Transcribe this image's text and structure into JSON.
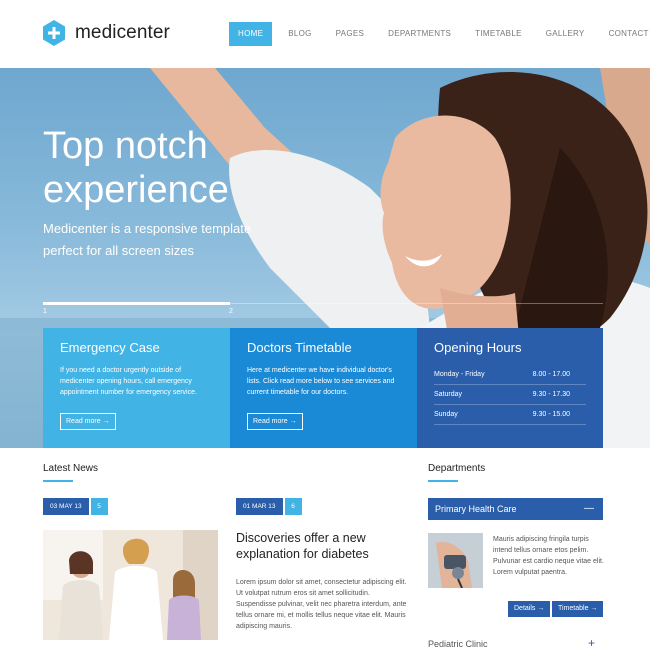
{
  "brand": {
    "name": "medicenter",
    "color": "#42b3e5"
  },
  "nav": [
    {
      "label": "HOME",
      "active": true
    },
    {
      "label": "BLOG"
    },
    {
      "label": "PAGES"
    },
    {
      "label": "DEPARTMENTS"
    },
    {
      "label": "TIMETABLE"
    },
    {
      "label": "GALLERY"
    },
    {
      "label": "CONTACT"
    }
  ],
  "hero": {
    "title_line1": "Top notch",
    "title_line2": "experience",
    "subtitle_line1": "Medicenter is a responsive template",
    "subtitle_line2": "perfect for all screen sizes",
    "slides": [
      "1",
      "2"
    ]
  },
  "boxes": {
    "emergency": {
      "title": "Emergency Case",
      "text": "If you need a doctor urgently outside of medicenter opening hours, call emergency appointment number for emergency service.",
      "button": "Read more →"
    },
    "timetable": {
      "title": "Doctors Timetable",
      "text": "Here at medicenter we have individual doctor's lists. Click read more below to see services and current timetable for our doctors.",
      "button": "Read more →"
    },
    "hours": {
      "title": "Opening Hours",
      "rows": [
        {
          "day": "Monday - Friday",
          "time": "8.00 - 17.00"
        },
        {
          "day": "Saturday",
          "time": "9.30 - 17.30"
        },
        {
          "day": "Sunday",
          "time": "9.30 - 15.00"
        }
      ]
    }
  },
  "news": {
    "heading": "Latest News",
    "items": [
      {
        "date": "03 MAY 13",
        "count": "5"
      },
      {
        "date": "01 MAR 13",
        "count": "6",
        "title": "Discoveries offer a new explanation for diabetes",
        "text": "Lorem ipsum dolor sit amet, consectetur adipiscing elit. Ut volutpat rutrum eros sit amet sollicitudin. Suspendisse pulvinar, velit nec pharetra interdum, ante tellus ornare mi, et mollis tellus neque vitae elit. Mauris adipiscing mauris."
      }
    ]
  },
  "departments": {
    "heading": "Departments",
    "open": {
      "title": "Primary Health Care",
      "text": "Mauris adipiscing fringila turpis intend tellus ornare etos pelim. Pulvunar est cardio neque vitae elit. Lorem vulputat paentra.",
      "details_button": "Details →",
      "timetable_button": "Timetable →"
    },
    "next": "Pediatric Clinic"
  }
}
